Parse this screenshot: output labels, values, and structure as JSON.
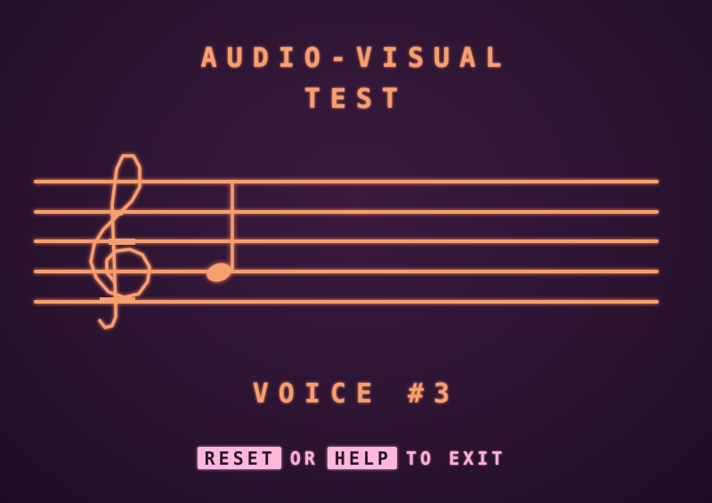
{
  "title": {
    "line1": "AUDIO-VISUAL",
    "line2": "TEST"
  },
  "voice": {
    "label": "VOICE #3"
  },
  "exit_prompt": {
    "key1": "RESET",
    "connector": "OR",
    "key2": "HELP",
    "suffix": "TO EXIT"
  },
  "staff": {
    "clef_icon": "treble-clef-icon",
    "note_icon": "quarter-note-icon",
    "lines": 5
  },
  "colors": {
    "background": "#2c1431",
    "foreground": "#f6a070",
    "key_highlight": "#ffb8dc"
  }
}
